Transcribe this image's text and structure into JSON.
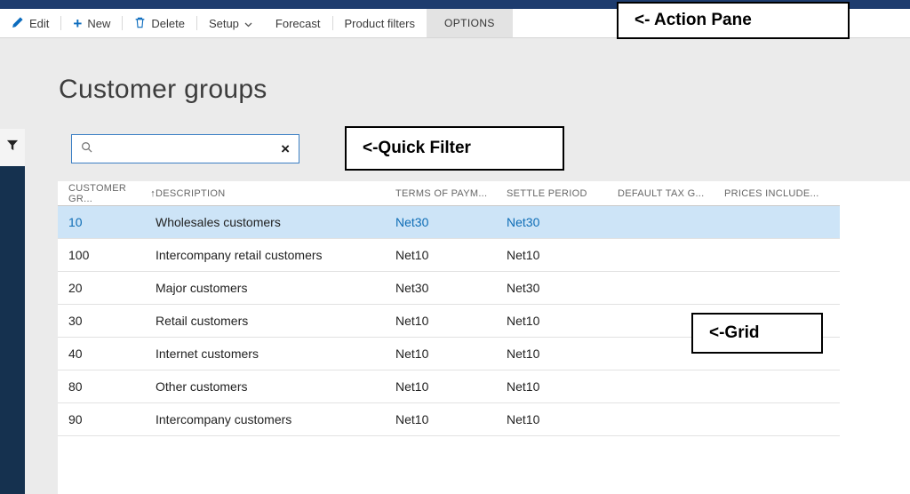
{
  "action_pane": {
    "edit_label": "Edit",
    "new_label": "New",
    "delete_label": "Delete",
    "setup_label": "Setup",
    "forecast_label": "Forecast",
    "product_filters_label": "Product filters",
    "options_label": "OPTIONS"
  },
  "annotations": {
    "action_pane": "<- Action Pane",
    "quick_filter": "<-Quick Filter",
    "grid": "<-Grid"
  },
  "page": {
    "title": "Customer groups"
  },
  "quick_filter": {
    "value": "",
    "placeholder": "",
    "clear_glyph": "×"
  },
  "grid": {
    "columns": [
      "CUSTOMER GR...",
      "DESCRIPTION",
      "TERMS OF PAYM...",
      "SETTLE PERIOD",
      "DEFAULT TAX G...",
      "PRICES INCLUDE..."
    ],
    "sort_indicator": "↑",
    "rows": [
      {
        "id": "10",
        "description": "Wholesales customers",
        "terms": "Net30",
        "settle": "Net30",
        "default_tax": "",
        "prices_include": "",
        "selected": true
      },
      {
        "id": "100",
        "description": "Intercompany retail customers",
        "terms": "Net10",
        "settle": "Net10",
        "default_tax": "",
        "prices_include": "",
        "selected": false
      },
      {
        "id": "20",
        "description": "Major customers",
        "terms": "Net30",
        "settle": "Net30",
        "default_tax": "",
        "prices_include": "",
        "selected": false
      },
      {
        "id": "30",
        "description": "Retail customers",
        "terms": "Net10",
        "settle": "Net10",
        "default_tax": "",
        "prices_include": "",
        "selected": false
      },
      {
        "id": "40",
        "description": "Internet customers",
        "terms": "Net10",
        "settle": "Net10",
        "default_tax": "",
        "prices_include": "",
        "selected": false
      },
      {
        "id": "80",
        "description": "Other customers",
        "terms": "Net10",
        "settle": "Net10",
        "default_tax": "",
        "prices_include": "",
        "selected": false
      },
      {
        "id": "90",
        "description": "Intercompany  customers",
        "terms": "Net10",
        "settle": "Net10",
        "default_tax": "",
        "prices_include": "",
        "selected": false
      }
    ]
  },
  "colors": {
    "top_bar": "#1e3c6e",
    "left_rail": "#15314f",
    "accent_link_blue": "#0e6db6",
    "selected_row_bg": "#cde4f7",
    "action_icon_blue": "#0c6cbe",
    "quick_filter_border": "#3b7fc4"
  }
}
